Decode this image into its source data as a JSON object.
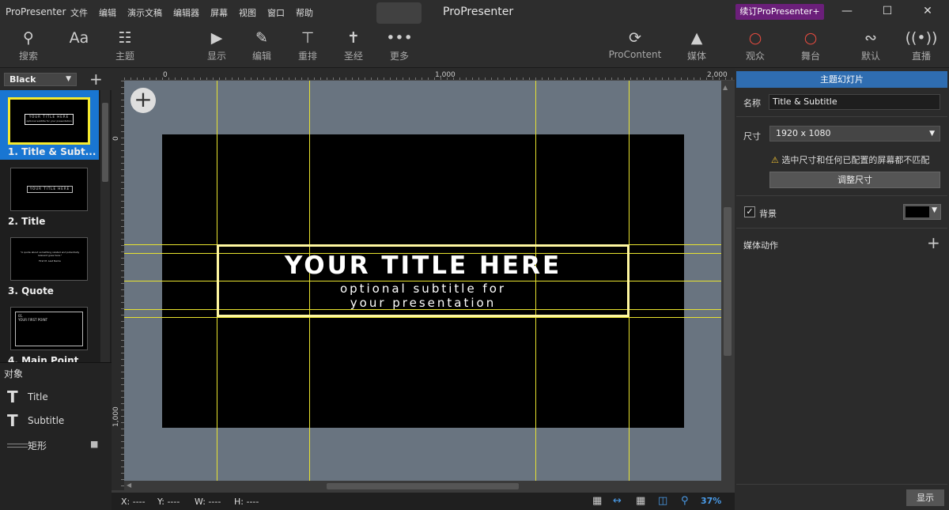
{
  "app": {
    "name": "ProPresenter",
    "window_title": "ProPresenter",
    "renew_label": "续订ProPresenter+"
  },
  "menu": [
    "文件",
    "编辑",
    "演示文稿",
    "编辑器",
    "屏幕",
    "视图",
    "窗口",
    "帮助"
  ],
  "toolbar": {
    "search": "搜索",
    "theme": "主题",
    "show": "显示",
    "edit": "编辑",
    "reflow": "重排",
    "bible": "圣经",
    "more": "更多",
    "procontent": "ProContent",
    "media": "媒体",
    "audience": "观众",
    "stage": "舞台",
    "default": "默认",
    "live": "直播",
    "text_icon_glyph": "Aa"
  },
  "left_panel": {
    "theme_select": "Black",
    "slides": [
      {
        "label": "1.  Title & Subt...",
        "thumb_title": "YOUR TITLE HERE",
        "thumb_sub": "optional subtitle for your presentation"
      },
      {
        "label": "2.  Title",
        "thumb_title": "YOUR TITLE HERE"
      },
      {
        "label": "3.  Quote",
        "thumb_title": "\"A quote about something related and potentially relevant goes here.\"",
        "thumb_sub": "First M. Last Name"
      },
      {
        "label": "4.  Main Point",
        "thumb_title": "01.",
        "thumb_sub": "YOUR FIRST POINT"
      }
    ],
    "objects_header": "对象",
    "objects": [
      {
        "icon": "T",
        "label": "Title"
      },
      {
        "icon": "T",
        "label": "Subtitle"
      },
      {
        "icon": "",
        "label": "矩形"
      }
    ]
  },
  "canvas": {
    "ruler_h": [
      "0",
      "1,000",
      "2,000"
    ],
    "ruler_v": [
      "0",
      "1,000"
    ],
    "slide_title": "YOUR TITLE HERE",
    "slide_subtitle_1": "optional subtitle for",
    "slide_subtitle_2": "your presentation",
    "add_glyph": "+"
  },
  "status": {
    "x": "X: ----",
    "y": "Y: ----",
    "w": "W: ----",
    "h": "H: ----",
    "zoom": "37%"
  },
  "right_panel": {
    "header": "主题幻灯片",
    "name_label": "名称",
    "name_value": "Title & Subtitle",
    "size_label": "尺寸",
    "size_value": "1920 x 1080",
    "warning": "选中尺寸和任何已配置的屏幕都不匹配",
    "resize_button": "调整尺寸",
    "background_label": "背景",
    "background_color": "#000000",
    "media_actions_label": "媒体动作",
    "show_button": "显示"
  },
  "colors": {
    "selection": "#1976d2",
    "guide": "#e8e330",
    "renew": "#6b1f7a",
    "live_red": "#e24b3f",
    "header_blue": "#2f6db1"
  }
}
